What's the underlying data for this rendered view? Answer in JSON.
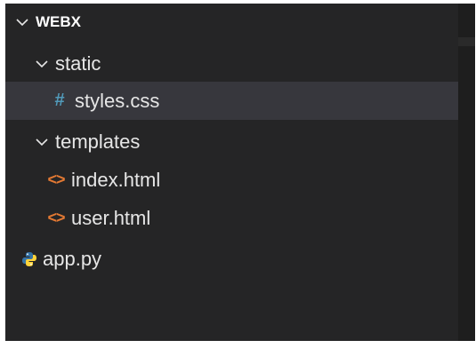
{
  "explorer": {
    "root_label": "WEBX",
    "items": [
      {
        "label": "static",
        "kind": "folder",
        "icon": "chevron-down-icon"
      },
      {
        "label": "styles.css",
        "kind": "file",
        "icon": "css-hash-icon",
        "icon_glyph": "#",
        "selected": true
      },
      {
        "label": "templates",
        "kind": "folder",
        "icon": "chevron-down-icon"
      },
      {
        "label": "index.html",
        "kind": "file",
        "icon": "html-tag-icon",
        "icon_glyph": "<>"
      },
      {
        "label": "user.html",
        "kind": "file",
        "icon": "html-tag-icon",
        "icon_glyph": "<>"
      },
      {
        "label": "app.py",
        "kind": "file",
        "icon": "python-icon"
      }
    ]
  },
  "colors": {
    "background": "#252526",
    "selected_row": "#37373d",
    "text": "#e6e6e6",
    "css_icon": "#519aba",
    "html_icon": "#e37933",
    "python_blue": "#3572a5",
    "python_yellow": "#ffd43b"
  }
}
